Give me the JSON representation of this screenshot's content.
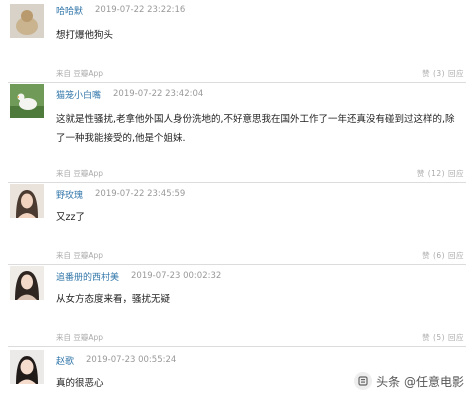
{
  "comments": [
    {
      "user": "哈哈默",
      "time": "2019-07-22 23:22:16",
      "text": "想打爆他狗头",
      "source": "来自 豆瓣App",
      "actions": "赞 (3) 回应"
    },
    {
      "user": "猫笼小白嘴",
      "time": "2019-07-22 23:42:04",
      "text": "这就是性骚扰,老拿他外国人身份洗地的,不好意思我在国外工作了一年还真没有碰到过这样的,除了一种我能接受的,他是个姐妹.",
      "source": "来自 豆瓣App",
      "actions": "赞 (12) 回应"
    },
    {
      "user": "野玫瑰",
      "time": "2019-07-22 23:45:59",
      "text": "又zz了",
      "source": "来自 豆瓣App",
      "actions": "赞 (6) 回应"
    },
    {
      "user": "追番册的西村美",
      "time": "2019-07-23 00:02:32",
      "text": "从女方态度来看，骚扰无疑",
      "source": "来自 豆瓣App",
      "actions": "赞 (5) 回应"
    },
    {
      "user": "赵歌",
      "time": "2019-07-23 00:55:24",
      "text": "真的很恶心"
    }
  ],
  "watermark": {
    "text": "头条 @任意电影",
    "icon": "toutiao-logo-icon"
  },
  "colors": {
    "username": "#3377aa",
    "timestamp": "#999999",
    "meta": "#aaaaaa",
    "divider": "#dcdcdc"
  }
}
